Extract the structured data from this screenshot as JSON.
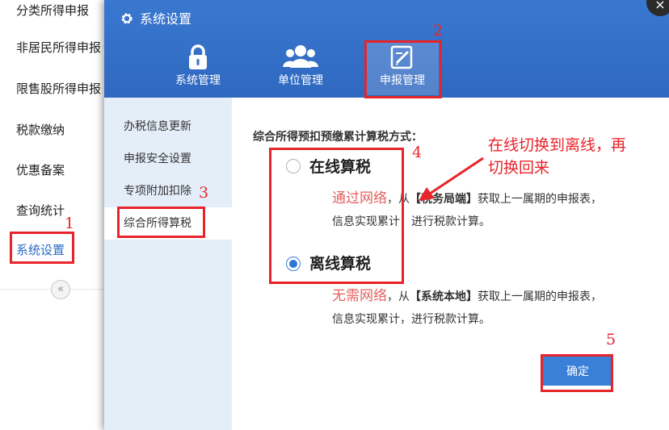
{
  "left_nav": {
    "items": [
      {
        "label": "分类所得申报"
      },
      {
        "label": "非居民所得申报"
      },
      {
        "label": "限售股所得申报"
      },
      {
        "label": "税款缴纳"
      },
      {
        "label": "优惠备案"
      },
      {
        "label": "查询统计"
      },
      {
        "label": "系统设置"
      }
    ],
    "collapse_glyph": "«"
  },
  "dialog": {
    "title": "系统设置",
    "close_glyph": "×",
    "tabs": [
      {
        "label": "系统管理",
        "icon": "lock-icon"
      },
      {
        "label": "单位管理",
        "icon": "users-icon"
      },
      {
        "label": "申报管理",
        "icon": "edit-icon"
      }
    ],
    "sidebar": [
      {
        "label": "办税信息更新"
      },
      {
        "label": "申报安全设置"
      },
      {
        "label": "专项附加扣除"
      },
      {
        "label": "综合所得算税"
      }
    ],
    "content": {
      "heading": "综合所得预扣预缴累计算税方式：",
      "options": [
        {
          "label": "在线算税",
          "checked": false,
          "desc_red": "通过网络",
          "desc_mid": "，从",
          "desc_bold": "【税务局端】",
          "desc_rest": "获取上一属期的申报表，",
          "desc_line2": "信息实现累计，进行税款计算。"
        },
        {
          "label": "离线算税",
          "checked": true,
          "desc_red": "无需网络",
          "desc_mid": "，从",
          "desc_bold": "【系统本地】",
          "desc_rest": "获取上一属期的申报表，",
          "desc_line2": "信息实现累计，进行税款计算。"
        }
      ],
      "confirm_label": "确定"
    }
  },
  "annotations": {
    "numbers": [
      "1",
      "2",
      "3",
      "4",
      "5"
    ],
    "callout_line1": "在线切换到离线，再",
    "callout_line2": "切换回来"
  },
  "colors": {
    "header_blue": "#3a78d0",
    "sidebar_bg": "#e4eef9",
    "accent_blue": "#3a7fd8",
    "annotation_red": "#e8242b",
    "desc_red": "#e46060"
  }
}
